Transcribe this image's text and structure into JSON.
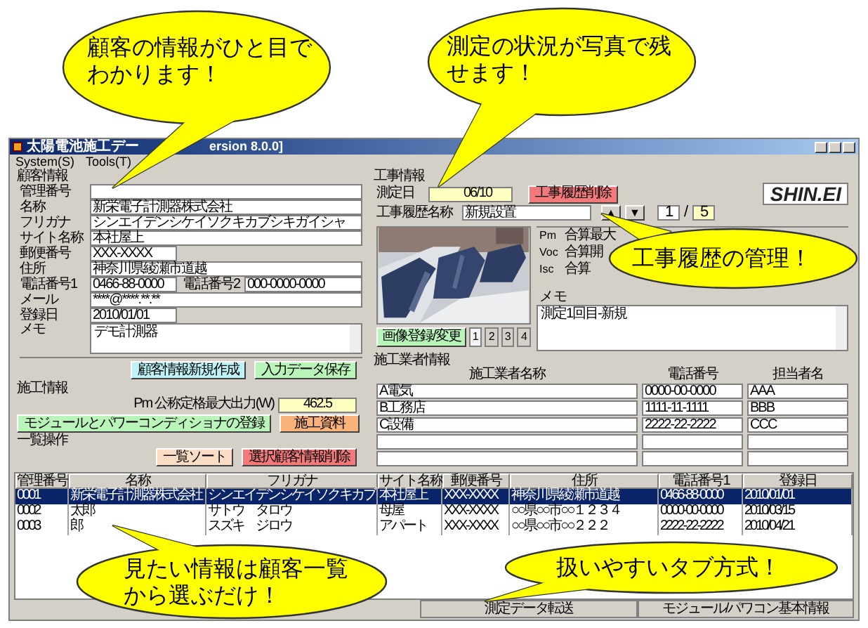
{
  "window": {
    "title": "太陽電池施工デー",
    "title_rest": "ersion 8.0.0]"
  },
  "menu": [
    "System(S)",
    "Tools(T)"
  ],
  "customer": {
    "title": "顧客情報",
    "fields": [
      {
        "label": "管理番号",
        "kind": "long"
      },
      {
        "label": "名称",
        "value": "新栄電子計測器株式会社",
        "kind": "long"
      },
      {
        "label": "フリガナ",
        "value": "シンエイデンシケイソクキカブシキガイシャ",
        "kind": "long"
      },
      {
        "label": "サイト名称",
        "value": "本社屋上",
        "kind": "long"
      },
      {
        "label": "郵便番号",
        "value": "XXX-XXXX",
        "kind": "short"
      },
      {
        "label": "住所",
        "value": "神奈川県綾瀬市道越",
        "kind": "long"
      },
      {
        "label": "電話番号1",
        "value": "0466-88-0000",
        "kind": "pair",
        "label2": "電話番号2",
        "value2": "000-0000-0000"
      },
      {
        "label": "メール",
        "value": "****@****.**.**",
        "kind": "long"
      },
      {
        "label": "登録日",
        "value": "2010/01/01",
        "kind": "short"
      }
    ],
    "memo_label": "メモ",
    "memo": "デモ計測器",
    "buttons": [
      {
        "label": "顧客情報新規作成",
        "color": "#bdf3f7"
      },
      {
        "label": "入力データ保存",
        "color": "#b9f5b9"
      }
    ]
  },
  "construction": {
    "title": "施工情報",
    "pm_label": "Pm 公称定格最大出力(W)",
    "pm_value": "462.5",
    "buttons": [
      {
        "label": "モジュールとパワーコンディショナの登録",
        "color": "#b9f5b9"
      },
      {
        "label": "施工資料",
        "color": "#f9b27a"
      }
    ]
  },
  "list_ops": {
    "title": "一覧操作",
    "buttons": [
      {
        "label": "一覧ソート",
        "color": "#fbdcc4"
      },
      {
        "label": "選択顧客情報削除",
        "color": "#f27a7a"
      }
    ]
  },
  "work": {
    "title": "工事情報",
    "date_label": "測定日",
    "date_value": "06/10",
    "delete_button": {
      "label": "工事履歴削除",
      "color": "#f27a7a"
    },
    "logo": "SHIN.EI",
    "name_label": "工事履歴名称",
    "name_value": "新規設置",
    "up": "▲",
    "down": "▼",
    "page": "1",
    "page_sep": "/",
    "page_total": "5",
    "measurements": [
      {
        "symbol": "Pm",
        "label": "合算最大"
      },
      {
        "symbol": "Voc",
        "label": "合算開"
      },
      {
        "symbol": "Isc",
        "label": "合算"
      }
    ],
    "memo_label": "メモ",
    "memo": "測定1回目-新規",
    "image_button": "画像登録/変更",
    "photo_tabs": [
      {
        "label": "1",
        "selected": true
      },
      {
        "label": "2",
        "selected": false
      },
      {
        "label": "3",
        "selected": false
      },
      {
        "label": "4",
        "selected": false
      }
    ]
  },
  "contractors": {
    "title": "施工業者情報",
    "columns": [
      "施工業者名称",
      "電話番号",
      "担当者名"
    ],
    "rows": [
      {
        "name": "A電気",
        "phone": "0000-00-0000",
        "person": "AAA"
      },
      {
        "name": "B工務店",
        "phone": "1111-11-1111",
        "person": "BBB"
      },
      {
        "name": "C設備",
        "phone": "2222-22-2222",
        "person": "CCC"
      }
    ]
  },
  "table": {
    "columns": [
      "管理番号",
      "名称",
      "フリガナ",
      "サイト名称",
      "郵便番号",
      "住所",
      "電話番号1",
      "登録日"
    ],
    "rows": [
      {
        "selected": true,
        "cells": [
          "0001",
          "新栄電子計測器株式会社",
          "シンエイデンシケイソクキカブ",
          "本社屋上",
          "XXX-XXXX",
          "神奈川県綾瀬市道越",
          "0466-88-0000",
          "2010/01/01"
        ]
      },
      {
        "selected": false,
        "cells": [
          "0002",
          "太郎",
          "サトウ　タロウ",
          "母屋",
          "XXX-XXXX",
          "○○県○○市○○１２３４",
          "0000-00-0000",
          "2010/03/15"
        ]
      },
      {
        "selected": false,
        "cells": [
          "0003",
          "郎",
          "スズキ　ジロウ",
          "アパート",
          "XXX-XXXX",
          "○○県○○市○○２２２",
          "2222-22-2222",
          "2010/04/21"
        ]
      }
    ]
  },
  "tabs": [
    {
      "label": "測定データ転送",
      "selected": false
    },
    {
      "label": "モジュール/パワコン基本情報",
      "selected": false
    }
  ],
  "callouts": [
    {
      "text": "顧客の情報がひと目でわかります！"
    },
    {
      "text": "測定の状況が写真で残せます！"
    },
    {
      "text": "工事履歴の管理！"
    },
    {
      "text": "見たい情報は顧客一覧から選ぶだけ！"
    },
    {
      "text": "扱いやすいタブ方式！"
    }
  ]
}
